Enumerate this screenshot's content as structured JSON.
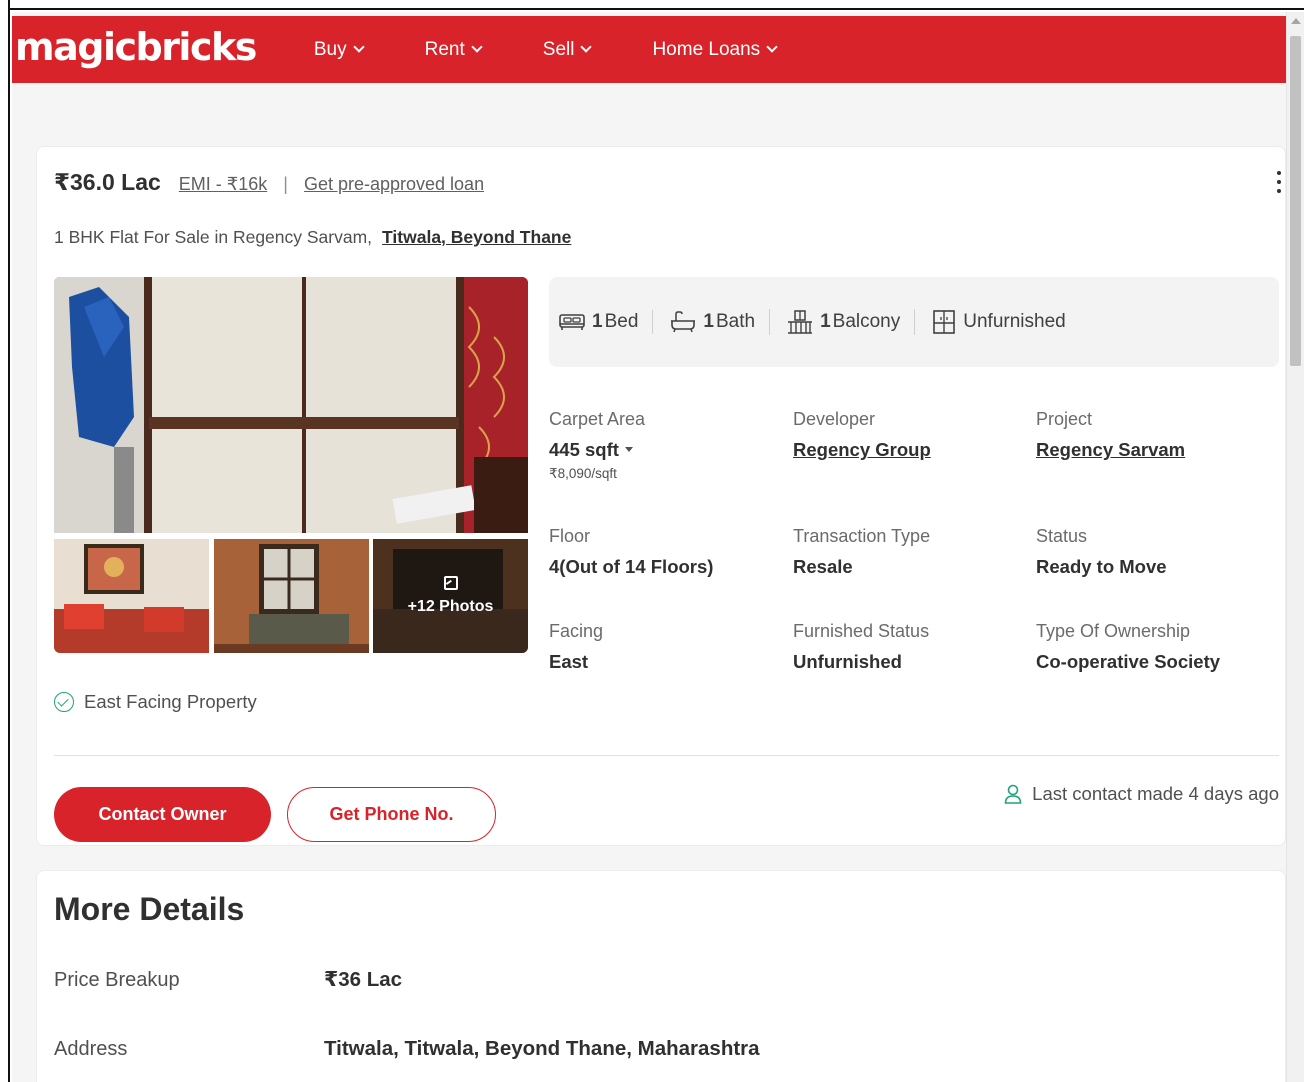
{
  "header": {
    "logo": "magicbricks",
    "nav": [
      {
        "label": "Buy"
      },
      {
        "label": "Rent"
      },
      {
        "label": "Sell"
      },
      {
        "label": "Home Loans"
      }
    ]
  },
  "listing": {
    "price": "₹36.0 Lac",
    "emi": "EMI - ₹16k",
    "separator": "|",
    "loan_link": "Get pre-approved loan",
    "title": "1 BHK Flat For Sale in Regency Sarvam,",
    "location": "Titwala, Beyond Thane",
    "photos_more": "+12 Photos",
    "amenities": [
      {
        "icon": "bed-icon",
        "count": "1",
        "label": "Bed"
      },
      {
        "icon": "bath-icon",
        "count": "1",
        "label": "Bath"
      },
      {
        "icon": "balcony-icon",
        "count": "1",
        "label": "Balcony"
      },
      {
        "icon": "furnishing-icon",
        "count": "",
        "label": "Unfurnished"
      }
    ],
    "details": {
      "carpet_area": {
        "label": "Carpet Area",
        "value": "445 sqft",
        "sub": "₹8,090/sqft"
      },
      "developer": {
        "label": "Developer",
        "value": "Regency Group"
      },
      "project": {
        "label": "Project",
        "value": "Regency Sarvam"
      },
      "floor": {
        "label": "Floor",
        "value": "4(Out of 14 Floors)"
      },
      "transaction": {
        "label": "Transaction Type",
        "value": "Resale"
      },
      "status": {
        "label": "Status",
        "value": "Ready to Move"
      },
      "facing": {
        "label": "Facing",
        "value": "East"
      },
      "furnished": {
        "label": "Furnished Status",
        "value": "Unfurnished"
      },
      "ownership": {
        "label": "Type Of Ownership",
        "value": "Co-operative Society"
      }
    },
    "feature": "East Facing Property",
    "contact_button": "Contact Owner",
    "phone_button": "Get Phone No.",
    "last_contact": "Last contact made 4 days ago"
  },
  "more_details": {
    "title": "More Details",
    "rows": [
      {
        "label": "Price Breakup",
        "value": "₹36 Lac"
      },
      {
        "label": "Address",
        "value": "Titwala, Titwala, Beyond Thane, Maharashtra"
      }
    ]
  },
  "colors": {
    "brand": "#d8232a",
    "success": "#1fa37a",
    "text": "#303030"
  }
}
